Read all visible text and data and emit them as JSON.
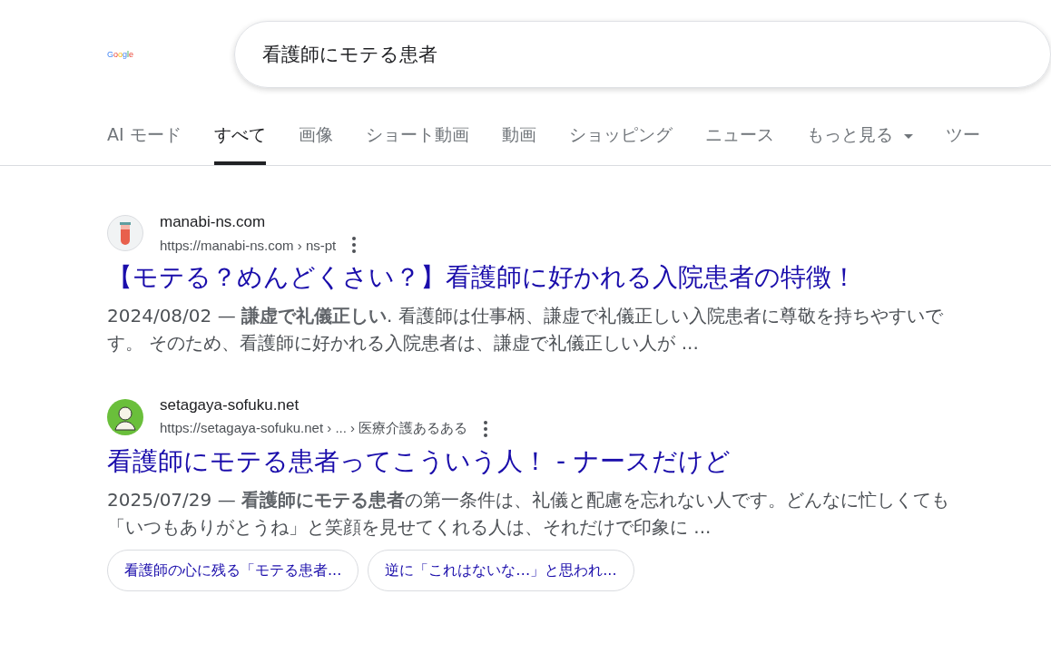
{
  "logo": "Google",
  "search": {
    "value": "看護師にモテる患者"
  },
  "tabs": [
    {
      "label": "AI モード",
      "selected": false,
      "dropdown": false
    },
    {
      "label": "すべて",
      "selected": true,
      "dropdown": false
    },
    {
      "label": "画像",
      "selected": false,
      "dropdown": false
    },
    {
      "label": "ショート動画",
      "selected": false,
      "dropdown": false
    },
    {
      "label": "動画",
      "selected": false,
      "dropdown": false
    },
    {
      "label": "ショッピング",
      "selected": false,
      "dropdown": false
    },
    {
      "label": "ニュース",
      "selected": false,
      "dropdown": false
    },
    {
      "label": "もっと見る",
      "selected": false,
      "dropdown": true
    },
    {
      "label": "ツー",
      "selected": false,
      "dropdown": false
    }
  ],
  "results": [
    {
      "kind": "tube",
      "site": "manabi-ns.com",
      "url": "https://manabi-ns.com › ns-pt",
      "title": "【モテる？めんどくさい？】看護師に好かれる入院患者の特徴！",
      "snippet": "2024/08/02 — **謙虚で礼儀正しい**. 看護師は仕事柄、謙虚で礼儀正しい入院患者に尊敬を持ちやすいです。 そのため、看護師に好かれる入院患者は、謙虚で礼儀正しい人が ..."
    },
    {
      "kind": "person",
      "site": "setagaya-sofuku.net",
      "url": "https://setagaya-sofuku.net › ... › 医療介護あるある",
      "title": "看護師にモテる患者ってこういう人！ - ナースだけど",
      "snippet": "2025/07/29 — **看護師にモテる患者**の第一条件は、礼儀と配慮を忘れない人です。どんなに忙しくても「いつもありがとうね」と笑顔を見せてくれる人は、それだけで印象に ...",
      "chips": [
        "看護師の心に残る「モテる患者...",
        "逆に「これはないな…」と思われ..."
      ]
    }
  ]
}
